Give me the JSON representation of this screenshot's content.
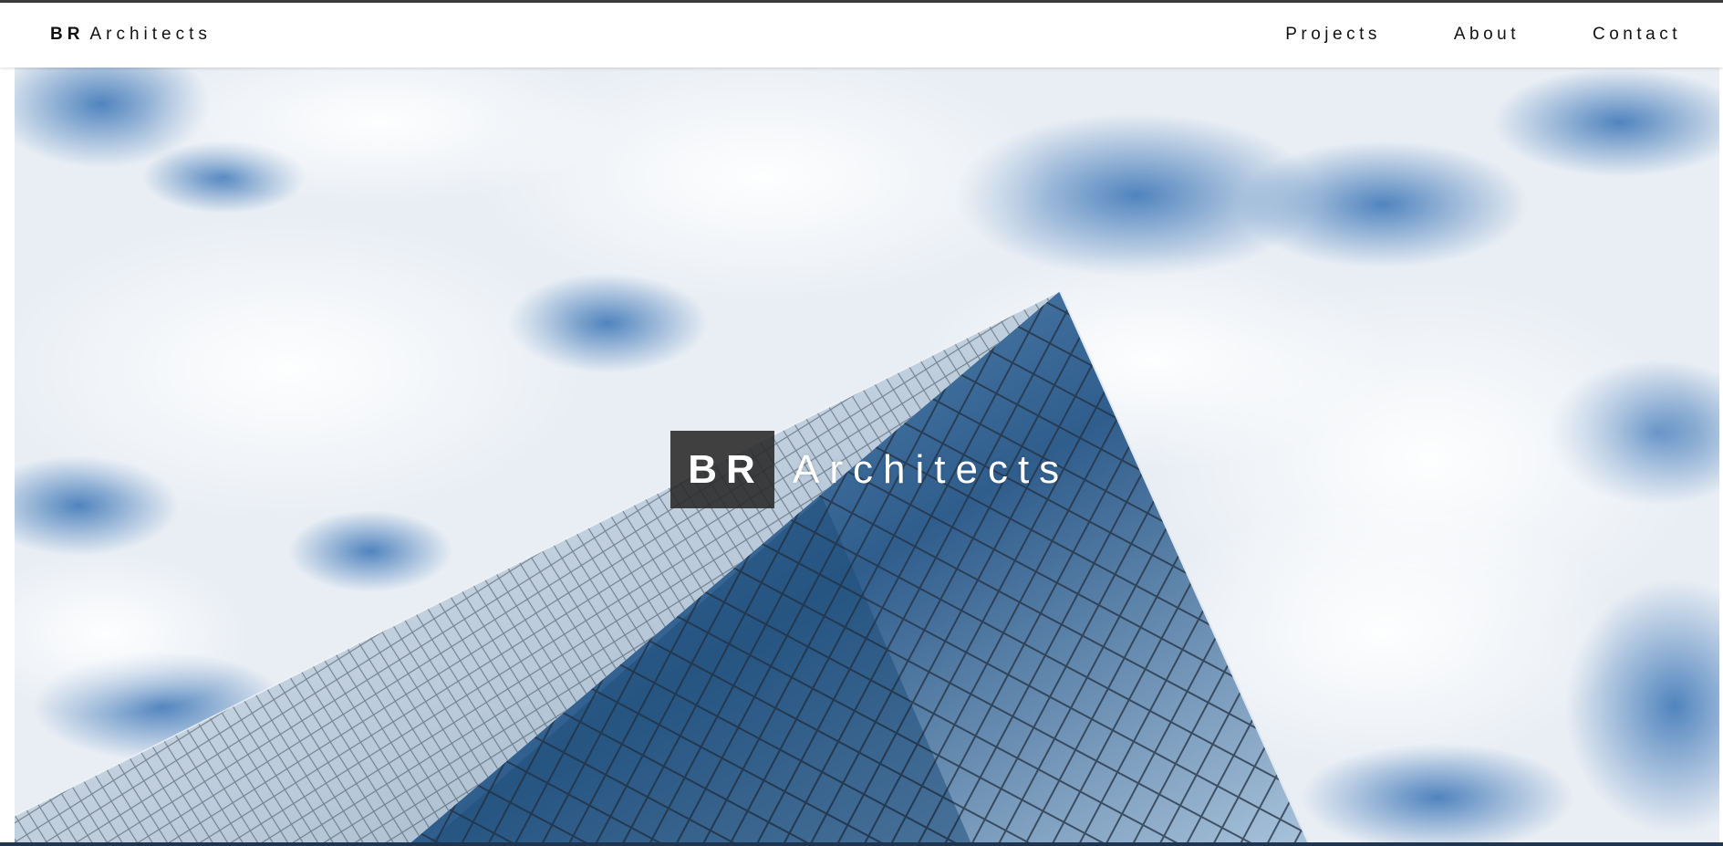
{
  "header": {
    "brand_bold": "BR",
    "brand_rest": "Architects"
  },
  "nav": {
    "items": [
      "Projects",
      "About",
      "Contact"
    ]
  },
  "hero": {
    "title_bold": "BR",
    "title_rest": "Architects",
    "image_subject": "glass skyscraper against cloudy sky"
  },
  "colors": {
    "text": "#111111",
    "topline": "#3a3a3a",
    "sky": "#dfe6ee",
    "glass": "#2f5d8c",
    "title_box": "#282828"
  }
}
